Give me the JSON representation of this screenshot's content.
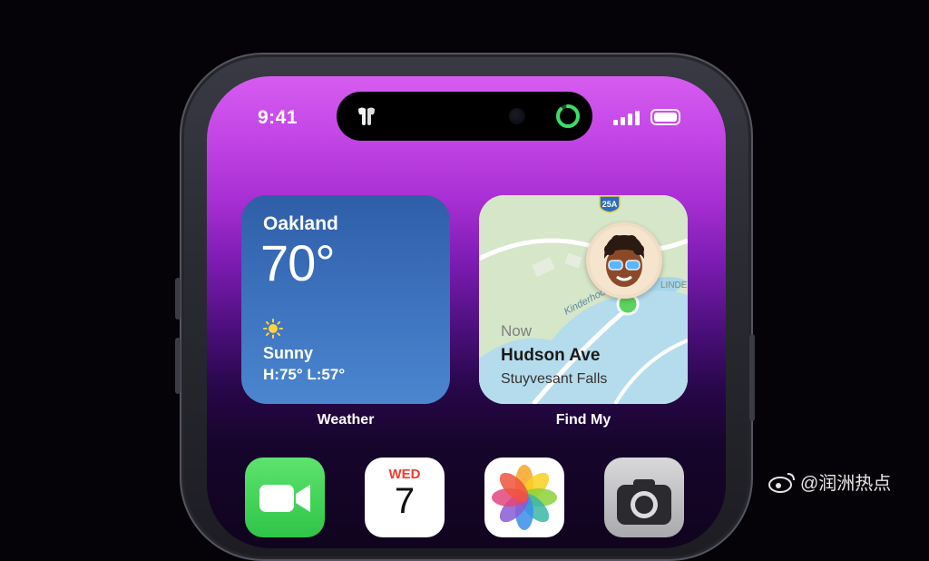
{
  "status_bar": {
    "time": "9:41"
  },
  "widgets": {
    "weather": {
      "city": "Oakland",
      "temperature": "70°",
      "condition": "Sunny",
      "high_low": "H:75° L:57°",
      "icon": "sun-icon",
      "label": "Weather"
    },
    "findmy": {
      "time": "Now",
      "place": "Hudson Ave",
      "locality": "Stuyvesant Falls",
      "route_badge": "25A",
      "street_label_1": "Kinderhook",
      "street_label_2": "LINDE",
      "icon": "avatar-icon",
      "label": "Find My"
    }
  },
  "dock_apps": [
    {
      "name": "FaceTime",
      "icon": "facetime-icon"
    },
    {
      "name": "Calendar",
      "icon": "calendar-icon",
      "day": "WED",
      "date": "7"
    },
    {
      "name": "Photos",
      "icon": "photos-icon"
    },
    {
      "name": "Camera",
      "icon": "camera-icon"
    }
  ],
  "watermark": "@润洲热点",
  "colors": {
    "wallpaper_top": "#d65cf0",
    "wallpaper_bottom": "#10041e",
    "weather_widget": "#3e74c0",
    "activity_ring": "#3ddc6a",
    "calendar_red": "#f23b30"
  }
}
